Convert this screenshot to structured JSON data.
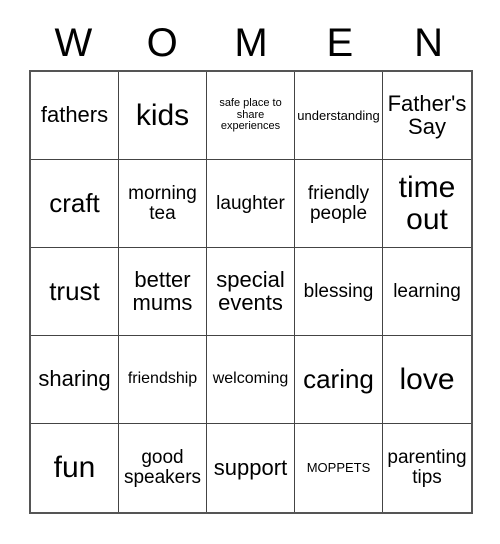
{
  "card": {
    "header_letters": [
      "W",
      "O",
      "M",
      "E",
      "N"
    ],
    "columns": 5,
    "rows": 5,
    "background_color": "#ffffff",
    "text_color": "#000000",
    "grid_line_color": "#444444",
    "grid_border_color": "#555555",
    "cells": [
      {
        "text": "fathers",
        "size": "fs-l"
      },
      {
        "text": "kids",
        "size": "fs-xxl"
      },
      {
        "text": "safe place to share experiences",
        "size": "fs-xxs"
      },
      {
        "text": "understanding",
        "size": "fs-xs"
      },
      {
        "text": "Father's Say",
        "size": "fs-l"
      },
      {
        "text": "craft",
        "size": "fs-xl"
      },
      {
        "text": "morning tea",
        "size": "fs-m"
      },
      {
        "text": "laughter",
        "size": "fs-m"
      },
      {
        "text": "friendly people",
        "size": "fs-m"
      },
      {
        "text": "time out",
        "size": "fs-xxl"
      },
      {
        "text": "trust",
        "size": "fs-xl"
      },
      {
        "text": "better mums",
        "size": "fs-l"
      },
      {
        "text": "special events",
        "size": "fs-l"
      },
      {
        "text": "blessing",
        "size": "fs-m"
      },
      {
        "text": "learning",
        "size": "fs-m"
      },
      {
        "text": "sharing",
        "size": "fs-l"
      },
      {
        "text": "friendship",
        "size": "fs-s"
      },
      {
        "text": "welcoming",
        "size": "fs-s"
      },
      {
        "text": "caring",
        "size": "fs-xl"
      },
      {
        "text": "love",
        "size": "fs-xxl"
      },
      {
        "text": "fun",
        "size": "fs-xxl"
      },
      {
        "text": "good speakers",
        "size": "fs-m"
      },
      {
        "text": "support",
        "size": "fs-l"
      },
      {
        "text": "MOPPETS",
        "size": "fs-xs"
      },
      {
        "text": "parenting tips",
        "size": "fs-m"
      }
    ]
  }
}
